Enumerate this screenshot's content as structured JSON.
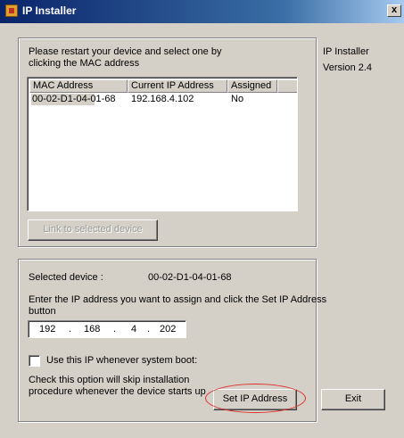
{
  "window": {
    "title": "IP Installer",
    "close_glyph": "x"
  },
  "side_info": {
    "product": "IP Installer",
    "version": "Version 2.4"
  },
  "device_group": {
    "instructions": "Please restart your device and select one by clicking the MAC address",
    "instructions_line1": "Please restart your device and select one by",
    "instructions_line2": "clicking the MAC address",
    "columns": [
      "MAC Address",
      "Current IP Address",
      "Assigned"
    ],
    "rows": [
      {
        "mac": "00-02-D1-04-01-68",
        "ip": "192.168.4.102",
        "assigned": "No"
      }
    ],
    "link_button": "Link to selected device"
  },
  "assign_group": {
    "selected_label": "Selected device :",
    "selected_value": "00-02-D1-04-01-68",
    "enter_text_line1": "Enter the IP address you want to assign and click the Set IP Address",
    "enter_text_line2": "button",
    "ip_octets": [
      "192",
      "168",
      "4",
      "202"
    ],
    "ip_dot": ".",
    "checkbox_label": "Use this IP whenever system boot:",
    "checkbox_checked": false,
    "note_line1": "Check this option will skip installation",
    "note_line2": "procedure whenever the device starts up",
    "set_button": "Set IP Address"
  },
  "exit_button": "Exit",
  "colors": {
    "highlight_ellipse": "#e03030",
    "titlebar": "#0a246a"
  }
}
